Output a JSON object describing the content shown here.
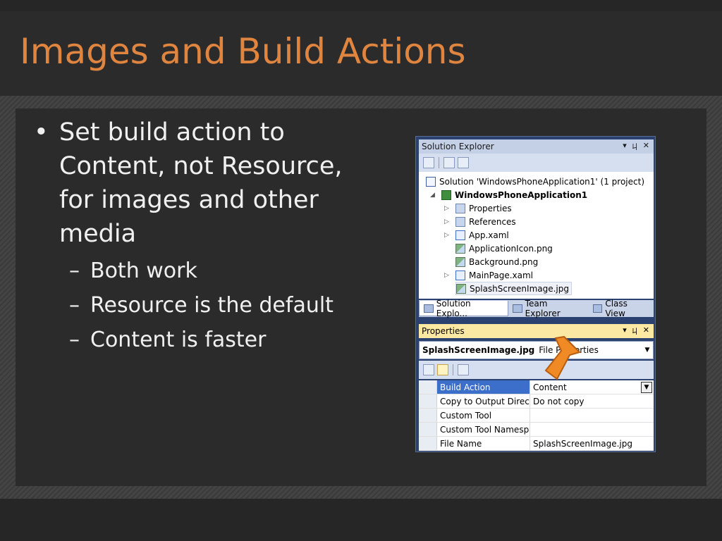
{
  "slide": {
    "title": "Images and Build Actions",
    "bullets": [
      {
        "text": "Set build action to Content, not Resource, for images and other media",
        "sub": [
          "Both work",
          "Resource is the default",
          "Content is faster"
        ]
      }
    ],
    "bullet_glyph": "•",
    "sub_glyph": "–"
  },
  "solution_explorer": {
    "title": "Solution Explorer",
    "header_tools": [
      "▾",
      "ㄐ",
      "✕"
    ],
    "solution": "Solution 'WindowsPhoneApplication1' (1 project)",
    "project": "WindowsPhoneApplication1",
    "items": [
      "Properties",
      "References",
      "App.xaml",
      "ApplicationIcon.png",
      "Background.png",
      "MainPage.xaml",
      "SplashScreenImage.jpg"
    ],
    "tabs": [
      "Solution Explo...",
      "Team Explorer",
      "Class View"
    ]
  },
  "properties": {
    "title": "Properties",
    "header_tools": [
      "▾",
      "ㄐ",
      "✕"
    ],
    "object_name": "SplashScreenImage.jpg",
    "object_type": "File Properties",
    "rows": [
      {
        "name": "Build Action",
        "value": "Content"
      },
      {
        "name": "Copy to Output Directory",
        "value": "Do not copy"
      },
      {
        "name": "Custom Tool",
        "value": ""
      },
      {
        "name": "Custom Tool Namespace",
        "value": ""
      },
      {
        "name": "File Name",
        "value": "SplashScreenImage.jpg"
      }
    ]
  },
  "colors": {
    "title": "#e08540",
    "text": "#f0f0f0",
    "callout_arrow": "#f08a24"
  }
}
